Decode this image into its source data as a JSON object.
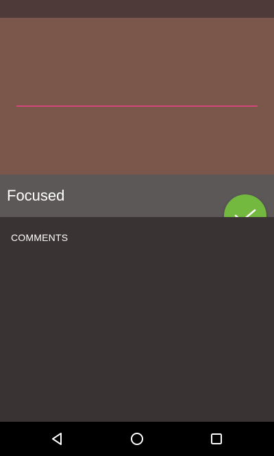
{
  "colors": {
    "status_bar": "#4e3a39",
    "hero": "#7a574a",
    "accent_line": "#d24679",
    "title_bar": "#5d5858",
    "fab": "#73b83f",
    "content": "#3a3334",
    "nav_bar": "#000000"
  },
  "title_bar": {
    "title": "Focused"
  },
  "fab": {
    "icon": "check-icon"
  },
  "content": {
    "section_label": "COMMENTS"
  },
  "nav": {
    "back_icon": "back-triangle-icon",
    "home_icon": "home-circle-icon",
    "recents_icon": "recents-square-icon"
  }
}
